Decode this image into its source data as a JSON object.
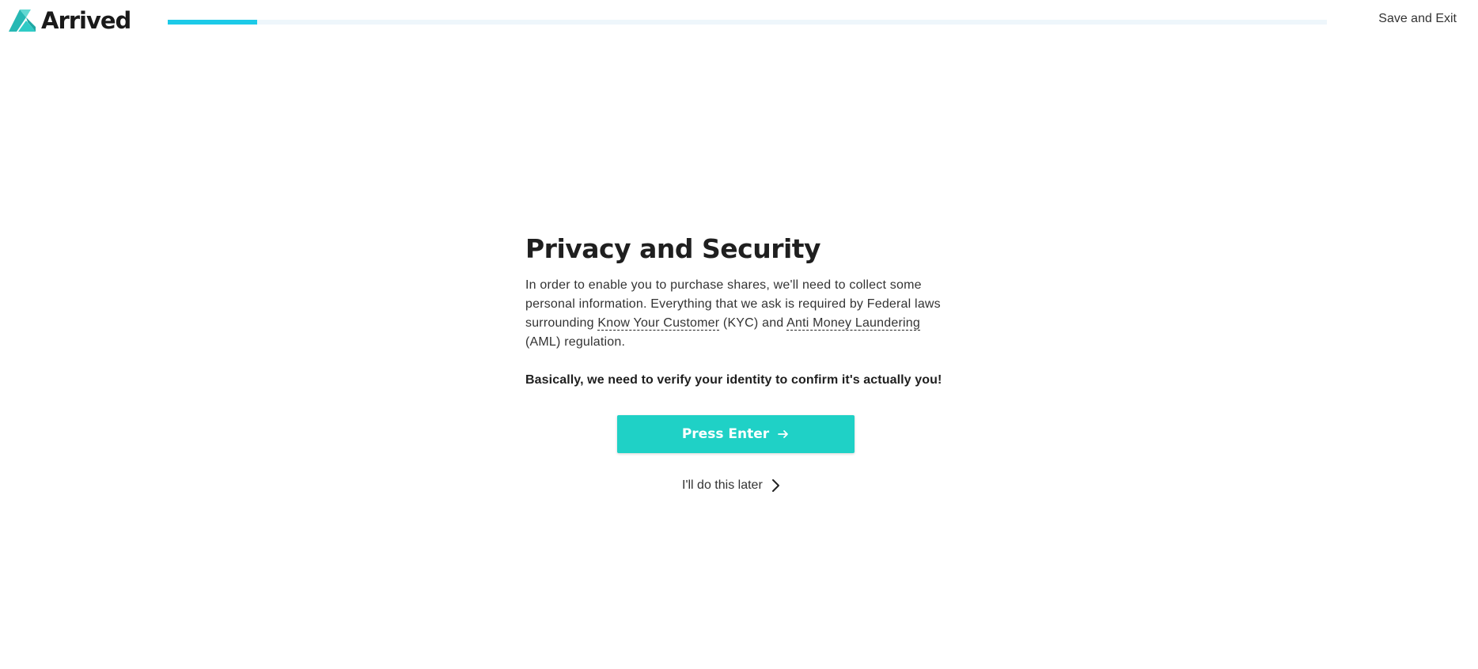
{
  "header": {
    "logo_text": "Arrived",
    "progress_percent": 7.7,
    "save_exit_label": "Save and Exit"
  },
  "main": {
    "title": "Privacy and Security",
    "para_part1": "In order to enable you to purchase shares, we'll need to collect some personal information. Everything that we ask is required by Federal laws surrounding ",
    "term_kyc": "Know Your Customer",
    "para_part2": " (KYC) and ",
    "term_aml": "Anti Money Laundering",
    "para_part3": " (AML) regulation.",
    "bold_line": "Basically, we need to verify your identity to confirm it's actually you!",
    "enter_label": "Press Enter",
    "later_label": "I'll do this later"
  },
  "colors": {
    "accent": "#1fd1c6",
    "progress": "#1ccae8",
    "logo_teal": "#27b8b4"
  },
  "icons": {
    "logo": "arrived-logo-icon",
    "enter_arrow": "arrow-right-icon",
    "later_chevron": "chevron-right-icon"
  }
}
